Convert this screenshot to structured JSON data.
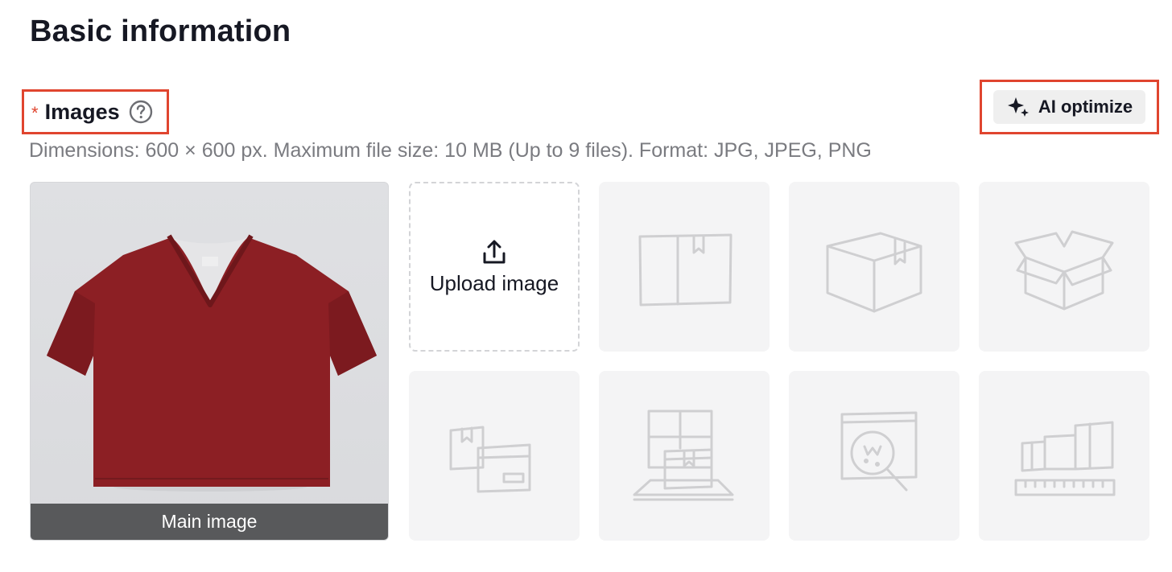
{
  "header": {
    "title": "Basic information"
  },
  "images_field": {
    "required_mark": "*",
    "label": "Images",
    "help_icon": "question-circle-icon",
    "hint": "Dimensions: 600 × 600 px. Maximum file size: 10 MB (Up to 9 files). Format: JPG, JPEG, PNG",
    "ai_button": {
      "label": "AI optimize",
      "icon": "sparkle-icon"
    },
    "main_image": {
      "caption": "Main image",
      "subject": "maroon v-neck t-shirt"
    },
    "upload": {
      "label": "Upload image",
      "icon": "upload-icon"
    },
    "slots": [
      {
        "icon": "box-front-icon"
      },
      {
        "icon": "box-angle-icon"
      },
      {
        "icon": "box-open-icon"
      },
      {
        "icon": "box-label-stack-icon"
      },
      {
        "icon": "box-on-scale-icon"
      },
      {
        "icon": "box-magnify-icon"
      },
      {
        "icon": "box-measure-icon"
      }
    ]
  },
  "colors": {
    "highlight": "#e0452f",
    "required": "#e0452f",
    "shirt": "#8c1f24",
    "caption_bg": "#58595b",
    "placeholder_bg": "#f4f4f5"
  }
}
